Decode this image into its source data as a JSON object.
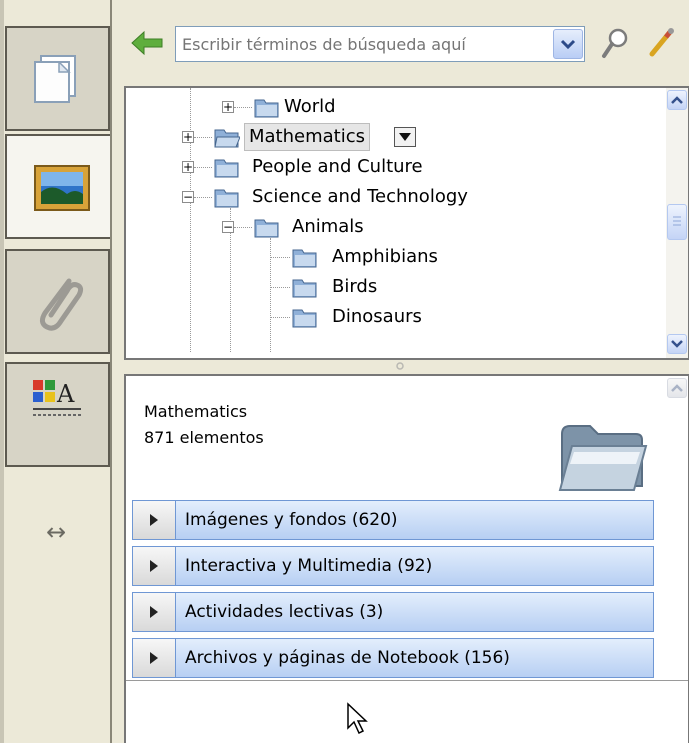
{
  "search": {
    "placeholder": "Escribir términos de búsqueda aquí"
  },
  "toolbar": {
    "back_icon": "green-left-arrow-icon",
    "search_icon": "magnifier-icon",
    "clear_icon": "pencil-icon"
  },
  "sidebar": {
    "tabs": [
      {
        "icon": "page-sorter-icon",
        "active": false
      },
      {
        "icon": "gallery-picture-icon",
        "active": true
      },
      {
        "icon": "paperclip-icon",
        "active": false
      },
      {
        "icon": "properties-icon",
        "active": false
      }
    ],
    "resize_icon": "double-arrow-icon"
  },
  "tree": {
    "nodes": [
      {
        "label": "World",
        "level": 2,
        "toggle": "+"
      },
      {
        "label": "Mathematics",
        "level": 1,
        "toggle": "+",
        "selected": true
      },
      {
        "label": "People and Culture",
        "level": 1,
        "toggle": "+"
      },
      {
        "label": "Science and Technology",
        "level": 1,
        "toggle": "−"
      },
      {
        "label": "Animals",
        "level": 2,
        "toggle": "−"
      },
      {
        "label": "Amphibians",
        "level": 3,
        "toggle": ""
      },
      {
        "label": "Birds",
        "level": 3,
        "toggle": ""
      },
      {
        "label": "Dinosaurs",
        "level": 3,
        "toggle": ""
      }
    ]
  },
  "details": {
    "title": "Mathematics",
    "count": "871 elementos",
    "categories": [
      "Imágenes y fondos (620)",
      "Interactiva y Multimedia (92)",
      "Actividades lectivas (3)",
      "Archivos y páginas de Notebook (156)"
    ]
  },
  "colors": {
    "accent": "#6f97d4",
    "border": "#777777",
    "background": "#ece9d8"
  }
}
